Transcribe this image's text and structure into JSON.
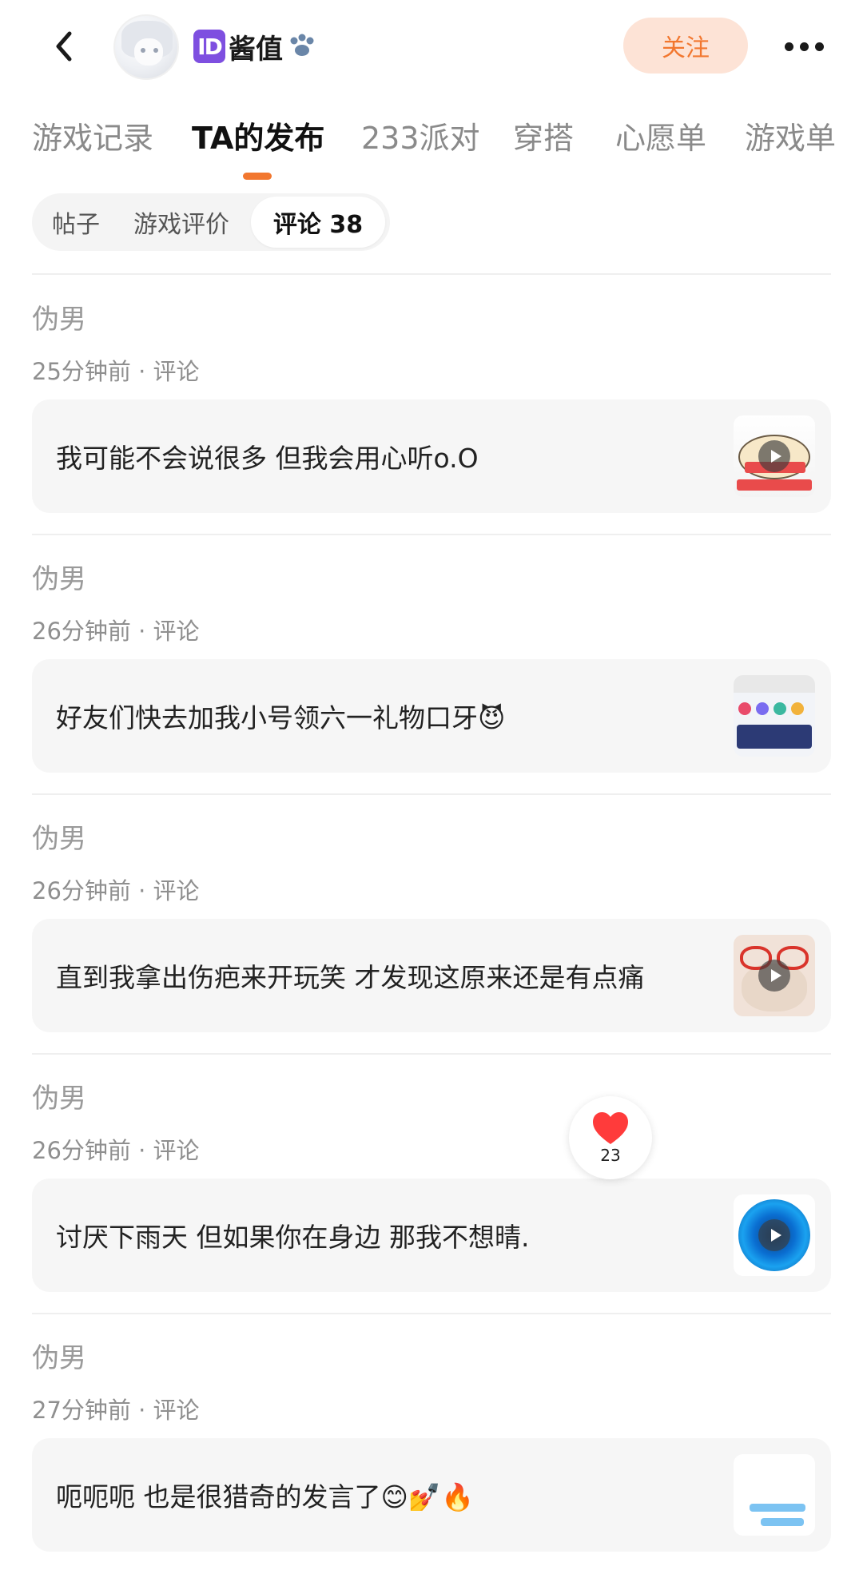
{
  "header": {
    "username": "酱值",
    "id_badge": "ID",
    "follow_label": "关注"
  },
  "tabs": [
    {
      "label": "游戏记录",
      "active": false
    },
    {
      "label": "TA的发布",
      "active": true
    },
    {
      "label": "233派对",
      "active": false
    },
    {
      "label": "穿搭",
      "active": false
    },
    {
      "label": "心愿单",
      "active": false
    },
    {
      "label": "游戏单",
      "active": false
    }
  ],
  "subtabs": [
    {
      "label": "帖子",
      "active": false
    },
    {
      "label": "游戏评价",
      "active": false
    },
    {
      "label": "评论 38",
      "active": true
    }
  ],
  "comments": [
    {
      "title": "伪男",
      "meta": "25分钟前 · 评论",
      "text": "我可能不会说很多 但我会用心听o.O",
      "thumb": "video"
    },
    {
      "title": "伪男",
      "meta": "26分钟前 · 评论",
      "text": "好友们快去加我小号领六一礼物口牙😈",
      "thumb": "image"
    },
    {
      "title": "伪男",
      "meta": "26分钟前 · 评论",
      "text": "直到我拿出伤疤来开玩笑 才发现这原来还是有点痛",
      "thumb": "video"
    },
    {
      "title": "伪男",
      "meta": "26分钟前 · 评论",
      "text": "讨厌下雨天 但如果你在身边 那我不想晴.",
      "thumb": "video"
    },
    {
      "title": "伪男",
      "meta": "27分钟前 · 评论",
      "text": "呃呃呃 也是很猎奇的发言了😊💅🔥",
      "thumb": "image"
    }
  ],
  "like": {
    "count": "23",
    "color": "#ff3b3b"
  },
  "colors": {
    "accent": "#f2772f",
    "follow_bg": "#fde3d6",
    "badge": "#7e4fe0"
  }
}
